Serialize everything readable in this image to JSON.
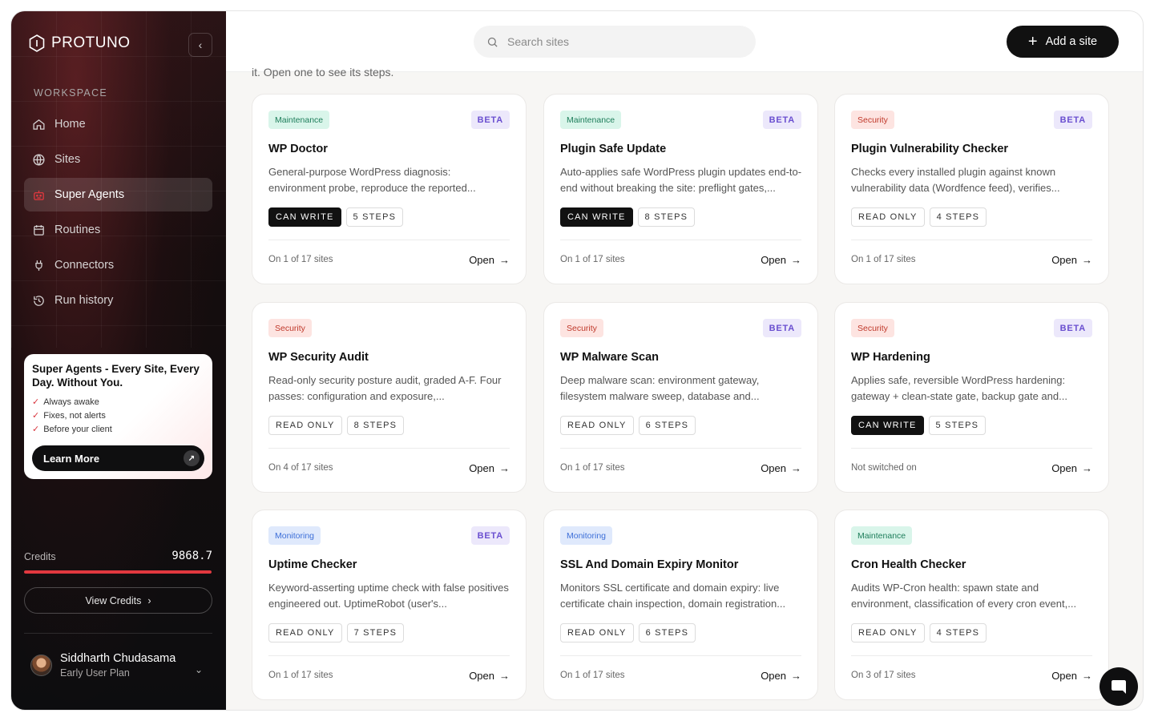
{
  "sidebar": {
    "brand": "PROTUNO",
    "workspace_label": "WORKSPACE",
    "items": [
      {
        "label": "Home",
        "icon": "home-icon"
      },
      {
        "label": "Sites",
        "icon": "globe-icon"
      },
      {
        "label": "Super Agents",
        "icon": "robot-icon",
        "active": true
      },
      {
        "label": "Routines",
        "icon": "calendar-icon"
      },
      {
        "label": "Connectors",
        "icon": "plug-icon"
      },
      {
        "label": "Run history",
        "icon": "history-icon"
      }
    ],
    "promo": {
      "title": "Super Agents - Every Site, Every Day. Without You.",
      "points": [
        "Always awake",
        "Fixes, not alerts",
        "Before your client"
      ],
      "button": "Learn More"
    },
    "credits": {
      "label": "Credits",
      "value": "9868.7",
      "fill_percent": 100,
      "view_label": "View Credits"
    },
    "user": {
      "name": "Siddharth Chudasama",
      "plan": "Early User Plan"
    }
  },
  "topbar": {
    "search_placeholder": "Search sites",
    "add_label": "Add a site"
  },
  "main": {
    "clipped_intro": "it. Open one to see its steps.",
    "cards": [
      {
        "category": "Maintenance",
        "kind": "maint",
        "beta": "BETA",
        "title": "WP Doctor",
        "desc": "General-purpose WordPress diagnosis: environment probe, reproduce the reported...",
        "access": "CAN WRITE",
        "steps": "5 STEPS",
        "status": "On 1 of 17 sites",
        "open": "Open"
      },
      {
        "category": "Maintenance",
        "kind": "maint",
        "beta": "BETA",
        "title": "Plugin Safe Update",
        "desc": "Auto-applies safe WordPress plugin updates end-to-end without breaking the site: preflight gates,...",
        "access": "CAN WRITE",
        "steps": "8 STEPS",
        "status": "On 1 of 17 sites",
        "open": "Open"
      },
      {
        "category": "Security",
        "kind": "sec",
        "beta": "BETA",
        "title": "Plugin Vulnerability Checker",
        "desc": "Checks every installed plugin against known vulnerability data (Wordfence feed), verifies...",
        "access": "READ ONLY",
        "steps": "4 STEPS",
        "status": "On 1 of 17 sites",
        "open": "Open"
      },
      {
        "category": "Security",
        "kind": "sec",
        "beta": "",
        "title": "WP Security Audit",
        "desc": "Read-only security posture audit, graded A-F. Four passes: configuration and exposure,...",
        "access": "READ ONLY",
        "steps": "8 STEPS",
        "status": "On 4 of 17 sites",
        "open": "Open"
      },
      {
        "category": "Security",
        "kind": "sec",
        "beta": "BETA",
        "title": "WP Malware Scan",
        "desc": "Deep malware scan: environment gateway, filesystem malware sweep, database and...",
        "access": "READ ONLY",
        "steps": "6 STEPS",
        "status": "On 1 of 17 sites",
        "open": "Open"
      },
      {
        "category": "Security",
        "kind": "sec",
        "beta": "BETA",
        "title": "WP Hardening",
        "desc": "Applies safe, reversible WordPress hardening: gateway + clean-state gate, backup gate and...",
        "access": "CAN WRITE",
        "steps": "5 STEPS",
        "status": "Not switched on",
        "open": "Open"
      },
      {
        "category": "Monitoring",
        "kind": "mon",
        "beta": "BETA",
        "title": "Uptime Checker",
        "desc": "Keyword-asserting uptime check with false positives engineered out. UptimeRobot (user's...",
        "access": "READ ONLY",
        "steps": "7 STEPS",
        "status": "On 1 of 17 sites",
        "open": "Open"
      },
      {
        "category": "Monitoring",
        "kind": "mon",
        "beta": "",
        "title": "SSL And Domain Expiry Monitor",
        "desc": "Monitors SSL certificate and domain expiry: live certificate chain inspection, domain registration...",
        "access": "READ ONLY",
        "steps": "6 STEPS",
        "status": "On 1 of 17 sites",
        "open": "Open"
      },
      {
        "category": "Maintenance",
        "kind": "maint",
        "beta": "",
        "title": "Cron Health Checker",
        "desc": "Audits WP-Cron health: spawn state and environment, classification of every cron event,...",
        "access": "READ ONLY",
        "steps": "4 STEPS",
        "status": "On 3 of 17 sites",
        "open": "Open"
      }
    ]
  },
  "colors": {
    "accent_red": "#e2383f",
    "beta_purple": "#6a4fd0",
    "maintenance_green": "#1d7d5a",
    "security_red": "#c0392b",
    "monitoring_blue": "#3d6fd8"
  },
  "chat_icon": "chat-icon"
}
